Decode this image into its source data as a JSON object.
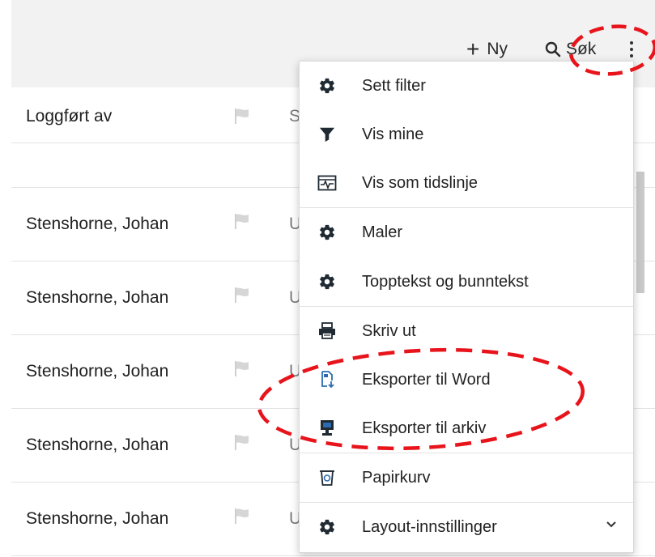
{
  "toolbar": {
    "new_label": "Ny",
    "search_label": "Søk"
  },
  "grid": {
    "header": {
      "logged_by": "Loggført av",
      "next_col": "S"
    },
    "rows": [
      {
        "logged_by": "Stenshorne, Johan",
        "next_col": "U"
      },
      {
        "logged_by": "Stenshorne, Johan",
        "next_col": "U"
      },
      {
        "logged_by": "Stenshorne, Johan",
        "next_col": "U"
      },
      {
        "logged_by": "Stenshorne, Johan",
        "next_col": "U"
      },
      {
        "logged_by": "Stenshorne, Johan",
        "next_col": "U"
      }
    ]
  },
  "menu": {
    "items": [
      {
        "label": "Sett filter",
        "icon": "gear-icon"
      },
      {
        "label": "Vis mine",
        "icon": "filter-funnel-icon"
      },
      {
        "label": "Vis som tidslinje",
        "icon": "timeline-icon"
      },
      {
        "label": "Maler",
        "icon": "gear-icon"
      },
      {
        "label": "Topptekst og bunntekst",
        "icon": "gear-icon"
      },
      {
        "label": "Skriv ut",
        "icon": "printer-icon"
      },
      {
        "label": "Eksporter til Word",
        "icon": "export-word-icon"
      },
      {
        "label": "Eksporter til arkiv",
        "icon": "export-archive-icon"
      },
      {
        "label": "Papirkurv",
        "icon": "recycle-bin-icon"
      },
      {
        "label": "Layout-innstillinger",
        "icon": "gear-icon"
      }
    ]
  },
  "colors": {
    "toolbar_bg": "#f2f2f2",
    "icon_dark": "#1f2a33",
    "annotation_red": "#e8141c",
    "flag_gray": "#cfcfcf"
  }
}
